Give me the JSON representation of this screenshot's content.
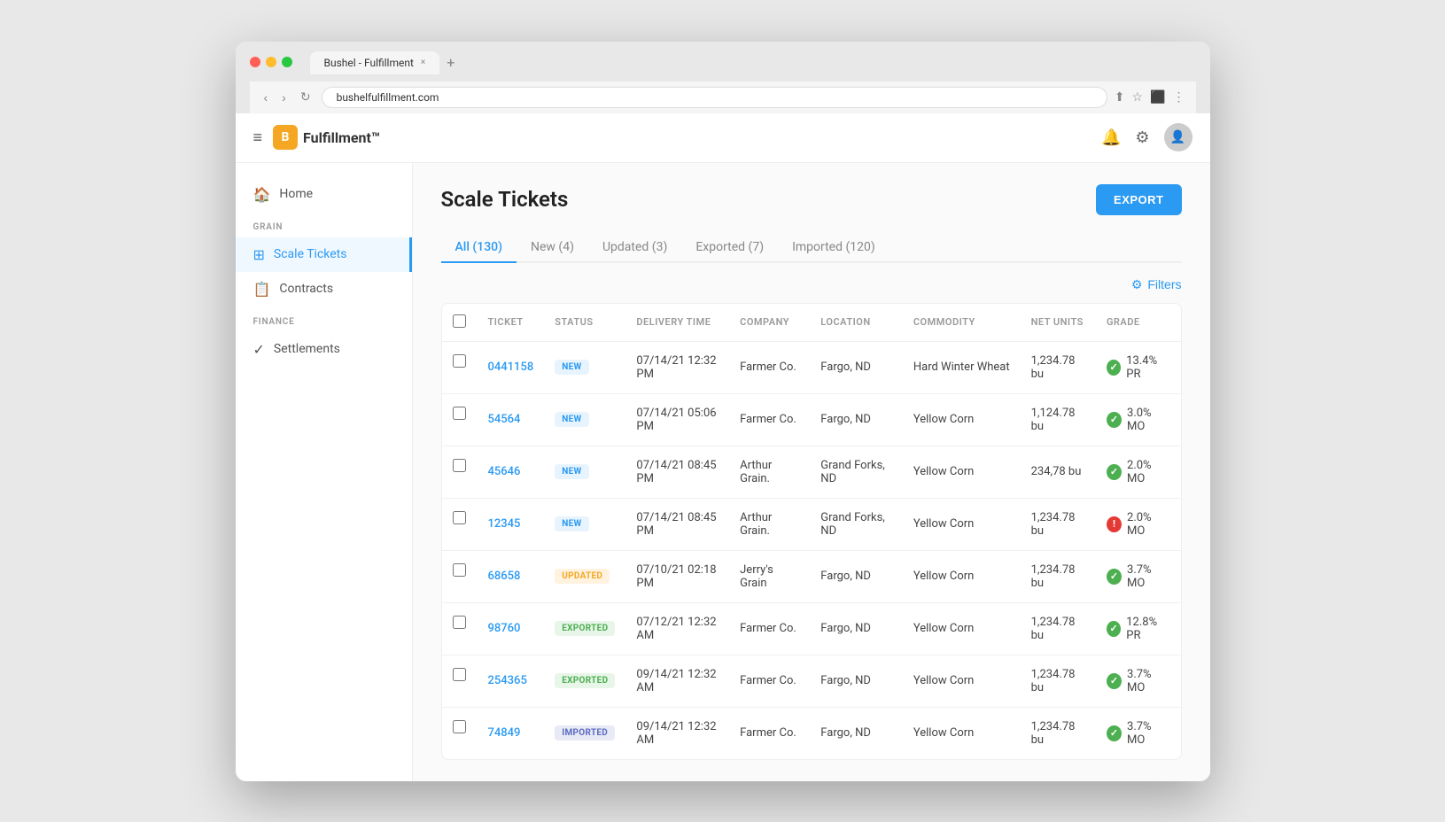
{
  "browser": {
    "tab_title": "Bushel - Fulfillment",
    "tab_close": "×",
    "tab_new": "+",
    "address": "bushelfulfillment.com",
    "nav_back": "‹",
    "nav_forward": "›",
    "nav_refresh": "↻"
  },
  "topbar": {
    "hamburger": "≡",
    "logo_text": "Fulfillment™",
    "logo_icon": "B",
    "bell_icon": "🔔",
    "gear_icon": "⚙",
    "user_icon": "👤"
  },
  "sidebar": {
    "home_label": "Home",
    "grain_section": "GRAIN",
    "scale_tickets_label": "Scale Tickets",
    "contracts_label": "Contracts",
    "finance_section": "FINANCE",
    "settlements_label": "Settlements"
  },
  "page": {
    "title": "Scale Tickets",
    "export_btn": "EXPORT",
    "filters_btn": "Filters"
  },
  "tabs": [
    {
      "label": "All (130)",
      "active": true
    },
    {
      "label": "New (4)",
      "active": false
    },
    {
      "label": "Updated (3)",
      "active": false
    },
    {
      "label": "Exported (7)",
      "active": false
    },
    {
      "label": "Imported (120)",
      "active": false
    }
  ],
  "table": {
    "columns": [
      "TICKET",
      "STATUS",
      "DELIVERY TIME",
      "COMPANY",
      "LOCATION",
      "COMMODITY",
      "NET UNITS",
      "GRADE"
    ],
    "rows": [
      {
        "ticket": "0441158",
        "status": "NEW",
        "status_type": "new",
        "delivery_time": "07/14/21 12:32 PM",
        "company": "Farmer Co.",
        "location": "Fargo, ND",
        "commodity": "Hard Winter Wheat",
        "net_units": "1,234.78 bu",
        "grade": "13.4% PR",
        "grade_ok": true
      },
      {
        "ticket": "54564",
        "status": "NEW",
        "status_type": "new",
        "delivery_time": "07/14/21 05:06 PM",
        "company": "Farmer Co.",
        "location": "Fargo, ND",
        "commodity": "Yellow Corn",
        "net_units": "1,124.78 bu",
        "grade": "3.0% MO",
        "grade_ok": true
      },
      {
        "ticket": "45646",
        "status": "NEW",
        "status_type": "new",
        "delivery_time": "07/14/21 08:45 PM",
        "company": "Arthur Grain.",
        "location": "Grand Forks, ND",
        "commodity": "Yellow Corn",
        "net_units": "234,78 bu",
        "grade": "2.0% MO",
        "grade_ok": true
      },
      {
        "ticket": "12345",
        "status": "NEW",
        "status_type": "new",
        "delivery_time": "07/14/21 08:45 PM",
        "company": "Arthur Grain.",
        "location": "Grand Forks, ND",
        "commodity": "Yellow Corn",
        "net_units": "1,234.78 bu",
        "grade": "2.0% MO",
        "grade_ok": false
      },
      {
        "ticket": "68658",
        "status": "UPDATED",
        "status_type": "updated",
        "delivery_time": "07/10/21 02:18 PM",
        "company": "Jerry's Grain",
        "location": "Fargo, ND",
        "commodity": "Yellow Corn",
        "net_units": "1,234.78 bu",
        "grade": "3.7% MO",
        "grade_ok": true
      },
      {
        "ticket": "98760",
        "status": "EXPORTED",
        "status_type": "exported",
        "delivery_time": "07/12/21 12:32 AM",
        "company": "Farmer Co.",
        "location": "Fargo, ND",
        "commodity": "Yellow Corn",
        "net_units": "1,234.78 bu",
        "grade": "12.8% PR",
        "grade_ok": true
      },
      {
        "ticket": "254365",
        "status": "EXPORTED",
        "status_type": "exported",
        "delivery_time": "09/14/21 12:32 AM",
        "company": "Farmer Co.",
        "location": "Fargo, ND",
        "commodity": "Yellow Corn",
        "net_units": "1,234.78 bu",
        "grade": "3.7% MO",
        "grade_ok": true
      },
      {
        "ticket": "74849",
        "status": "IMPORTED",
        "status_type": "imported",
        "delivery_time": "09/14/21 12:32 AM",
        "company": "Farmer Co.",
        "location": "Fargo, ND",
        "commodity": "Yellow Corn",
        "net_units": "1,234.78 bu",
        "grade": "3.7% MO",
        "grade_ok": true
      }
    ]
  }
}
